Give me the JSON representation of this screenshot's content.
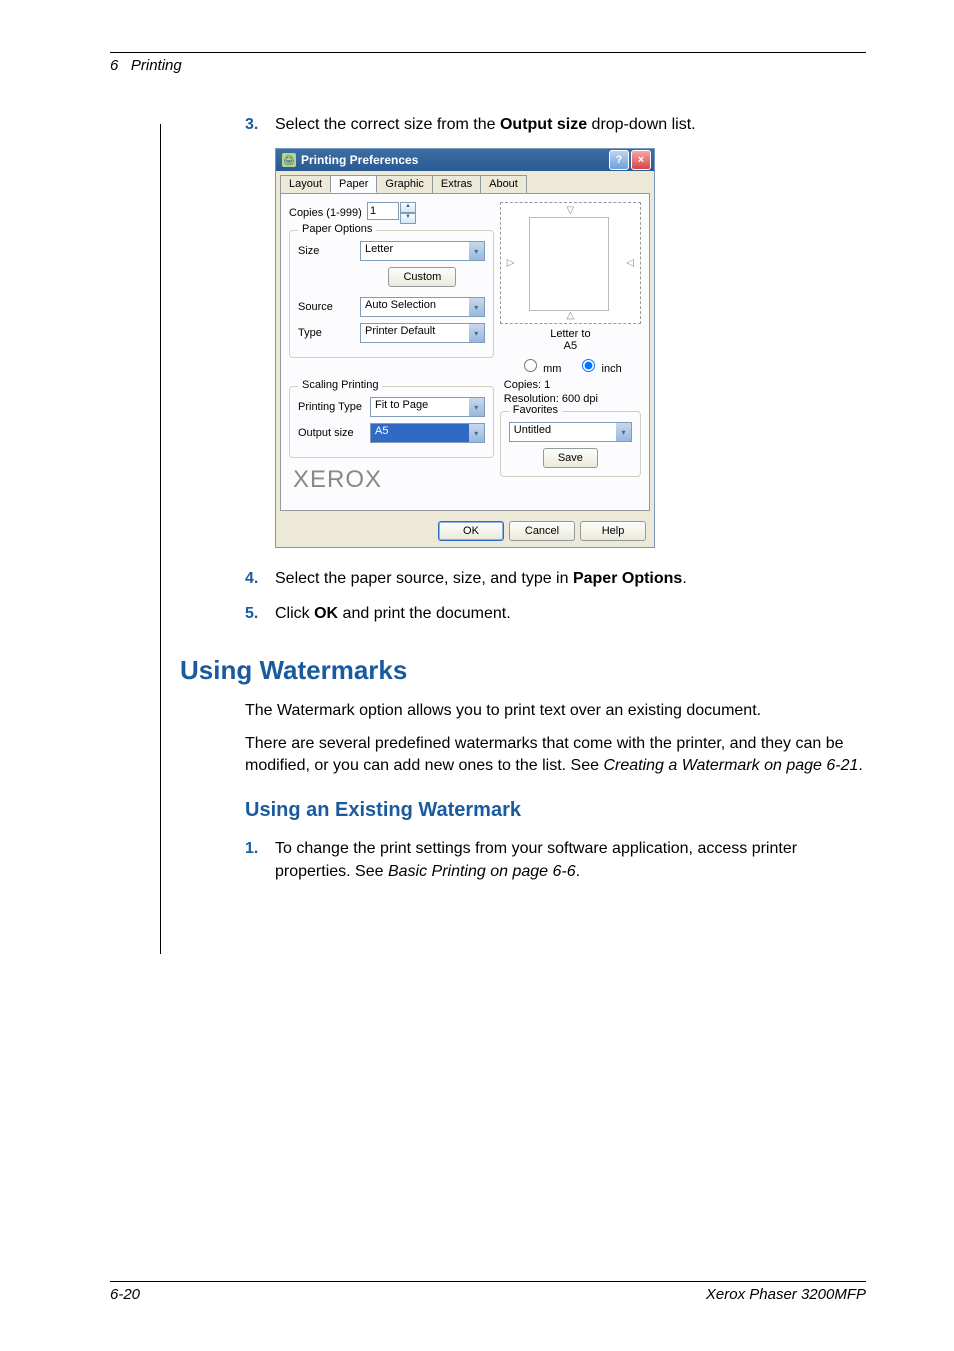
{
  "header": {
    "chapter": "6",
    "title": "Printing"
  },
  "steps_a": [
    {
      "num": "3.",
      "before": "Select the correct size from the ",
      "bold": "Output size",
      "after": " drop-down list."
    }
  ],
  "dialog": {
    "title": "Printing Preferences",
    "tabs": [
      "Layout",
      "Paper",
      "Graphic",
      "Extras",
      "About"
    ],
    "active_tab": "Paper",
    "copies_label": "Copies (1-999)",
    "copies_value": "1",
    "paper_options": {
      "legend": "Paper Options",
      "size_label": "Size",
      "size_value": "Letter",
      "custom_btn": "Custom",
      "source_label": "Source",
      "source_value": "Auto Selection",
      "type_label": "Type",
      "type_value": "Printer Default"
    },
    "scaling": {
      "legend": "Scaling Printing",
      "pt_label": "Printing Type",
      "pt_value": "Fit to Page",
      "out_label": "Output size",
      "out_value": "A5"
    },
    "preview": {
      "caption1": "Letter to",
      "caption2": "A5",
      "unit_mm": "mm",
      "unit_inch": "inch",
      "copies": "Copies: 1",
      "resolution": "Resolution: 600 dpi"
    },
    "favorites": {
      "legend": "Favorites",
      "value": "Untitled",
      "save": "Save"
    },
    "brand": "XEROX",
    "footer": {
      "ok": "OK",
      "cancel": "Cancel",
      "help": "Help"
    }
  },
  "steps_b": [
    {
      "num": "4.",
      "before": "Select the paper source, size, and type in ",
      "bold": "Paper Options",
      "after": "."
    },
    {
      "num": "5.",
      "before": "Click ",
      "bold": "OK",
      "after": " and print the document."
    }
  ],
  "h1": "Using Watermarks",
  "para1": "The Watermark option allows you to print text over an existing document.",
  "para2a": "There are several predefined watermarks that come with the printer, and they can be modified, or you can add new ones to the list.  See ",
  "para2b": "Creating a Watermark on page 6-21",
  "para2c": ".",
  "h2": "Using an Existing Watermark",
  "step_c": {
    "num": "1.",
    "t1": "To change the print settings from your software application, access printer properties. See ",
    "t2": "Basic Printing on page 6-6",
    "t3": "."
  },
  "footer": {
    "page": "6-20",
    "product": "Xerox Phaser 3200MFP"
  }
}
